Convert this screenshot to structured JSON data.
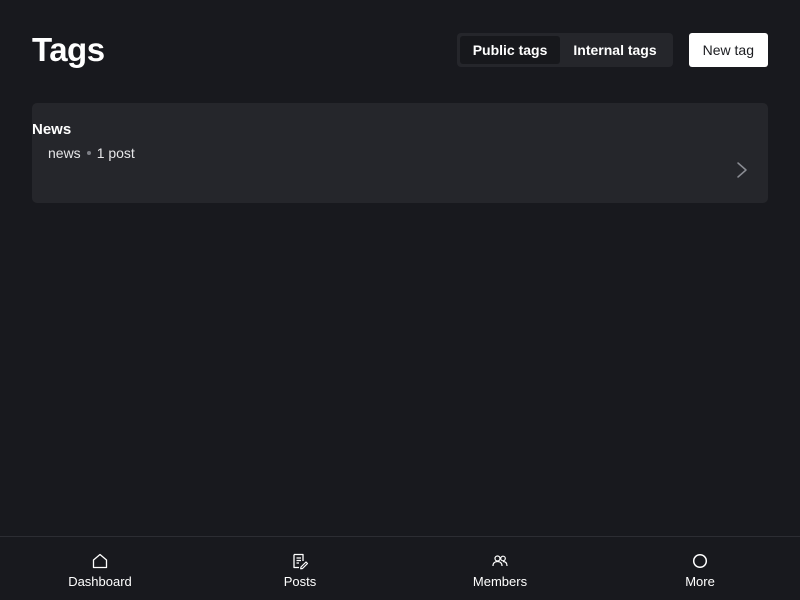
{
  "header": {
    "title": "Tags",
    "tabs": [
      {
        "label": "Public tags",
        "active": true
      },
      {
        "label": "Internal tags",
        "active": false
      }
    ],
    "new_tag_label": "New tag"
  },
  "tags": [
    {
      "name": "News",
      "slug": "news",
      "count": "1 post"
    }
  ],
  "bottom_nav": [
    {
      "label": "Dashboard",
      "icon": "home-icon"
    },
    {
      "label": "Posts",
      "icon": "posts-icon"
    },
    {
      "label": "Members",
      "icon": "members-icon"
    },
    {
      "label": "More",
      "icon": "circle-icon"
    }
  ],
  "colors": {
    "background": "#18191e",
    "card": "#25262b",
    "text": "#ffffff",
    "button_bg": "#ffffff",
    "button_text": "#1b1c20"
  }
}
